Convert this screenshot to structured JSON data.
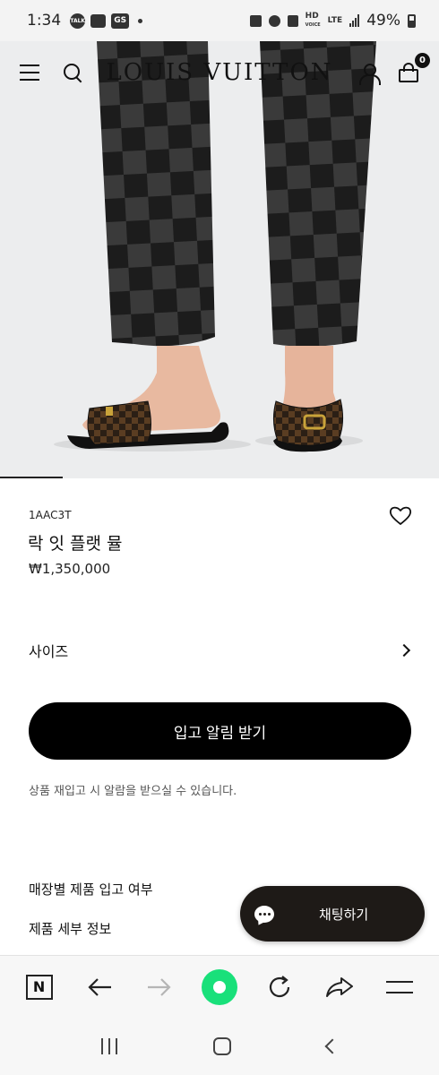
{
  "status_bar": {
    "time": "1:34",
    "notification_icons": [
      "talk-icon",
      "gallery-icon",
      "gs-icon"
    ],
    "gs_label": "GS",
    "hd_label": "HD",
    "voice_label": "VOICE",
    "lte_label": "LTE",
    "battery": "49%"
  },
  "header": {
    "brand": "LOUIS VUITTON",
    "cart_count": "0"
  },
  "product": {
    "sku": "1AAC3T",
    "name": "락 잇 플랫 뮬",
    "price": "₩1,350,000",
    "image_index": 1
  },
  "size": {
    "label": "사이즈"
  },
  "notify": {
    "button_label": "입고 알림 받기",
    "note": "상품 재입고 시 알람을 받으실 수 있습니다."
  },
  "links": {
    "store_availability": "매장별 제품 입고 여부",
    "product_details": "제품 세부 정보"
  },
  "chat": {
    "label": "채팅하기"
  },
  "browser_toolbar": {
    "items": [
      "naver-icon",
      "back-arrow-icon",
      "forward-arrow-icon",
      "home-icon",
      "refresh-icon",
      "share-icon",
      "menu-icon"
    ],
    "forward_disabled": true,
    "accent_color": "#19e07a"
  }
}
